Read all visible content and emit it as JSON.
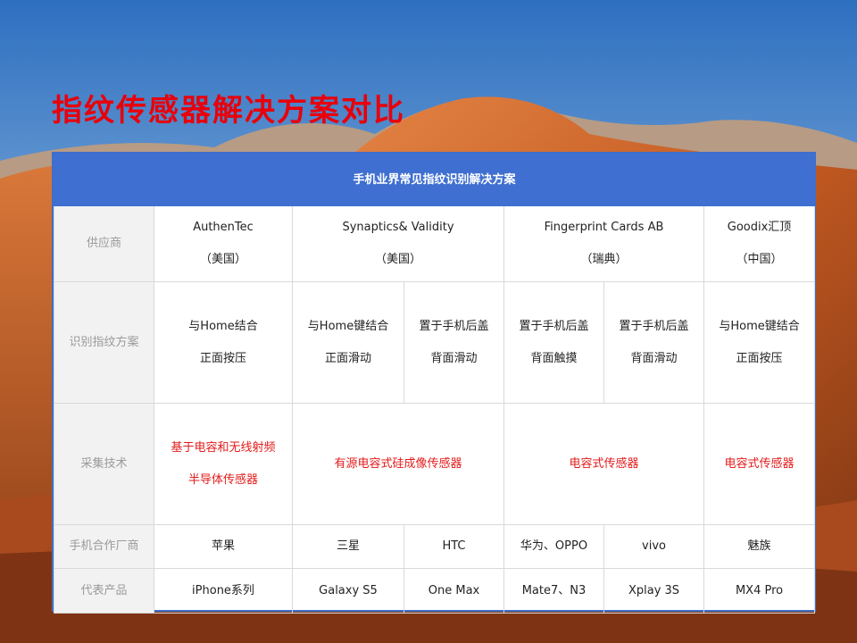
{
  "slide_title": "指纹传感器解决方案对比",
  "table": {
    "header": "手机业界常见指纹识别解决方案",
    "rows": {
      "vendor": {
        "label": "供应商",
        "cells": [
          {
            "name": "AuthenTec",
            "country": "（美国）"
          },
          {
            "name": "Synaptics& Validity",
            "country": "（美国）"
          },
          {
            "name": "Fingerprint Cards AB",
            "country": "（瑞典）"
          },
          {
            "name": "Goodix汇顶",
            "country": "（中国）"
          }
        ]
      },
      "scheme": {
        "label": "识别指纹方案",
        "cells": [
          {
            "l1": "与Home结合",
            "l2": "正面按压"
          },
          {
            "l1": "与Home键结合",
            "l2": "正面滑动"
          },
          {
            "l1": "置于手机后盖",
            "l2": "背面滑动"
          },
          {
            "l1": "置于手机后盖",
            "l2": "背面触摸"
          },
          {
            "l1": "置于手机后盖",
            "l2": "背面滑动"
          },
          {
            "l1": "与Home键结合",
            "l2": "正面按压"
          }
        ]
      },
      "tech": {
        "label": "采集技术",
        "cells": [
          {
            "l1": "基于电容和无线射频",
            "l2": "半导体传感器"
          },
          {
            "l1": "有源电容式硅成像传感器"
          },
          {
            "l1": "电容式传感器"
          },
          {
            "l1": "电容式传感器"
          }
        ]
      },
      "partners": {
        "label": "手机合作厂商",
        "cells": [
          "苹果",
          "三星",
          "HTC",
          "华为、OPPO",
          "vivo",
          "魅族"
        ]
      },
      "products": {
        "label": "代表产品",
        "cells": [
          "iPhone系列",
          "Galaxy S5",
          "One Max",
          "Mate7、N3",
          "Xplay 3S",
          "MX4 Pro"
        ]
      }
    }
  },
  "colors": {
    "title_red": "#e8000b",
    "header_blue": "#3f6fd0",
    "tech_red": "#e31b1b"
  }
}
